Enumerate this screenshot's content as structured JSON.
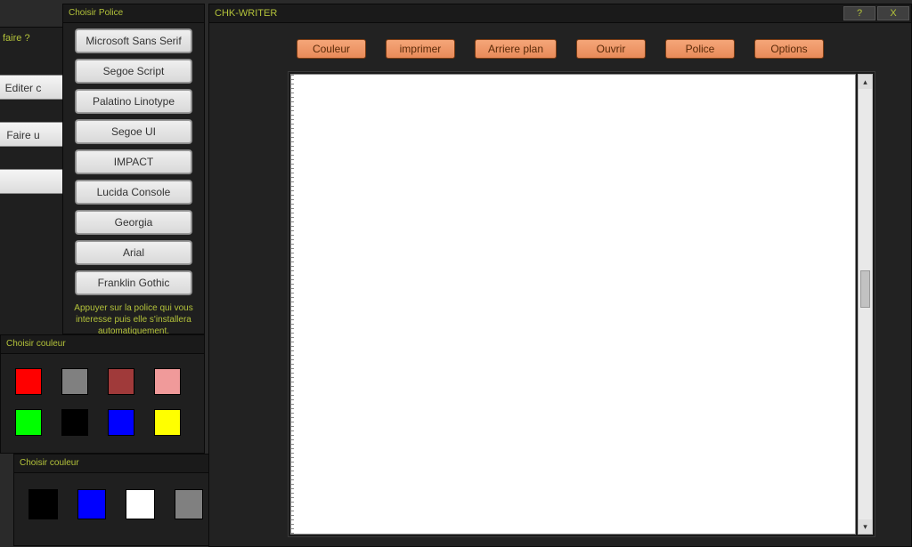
{
  "bgwin": {
    "question": "faire ?",
    "buttons": [
      "Editer c",
      "Faire u",
      ""
    ]
  },
  "fontwin": {
    "title": "Choisir Police",
    "fonts": [
      "Microsoft Sans Serif",
      "Segoe Script",
      "Palatino Linotype",
      "Segoe UI",
      "IMPACT",
      "Lucida Console",
      "Georgia",
      "Arial",
      "Franklin Gothic"
    ],
    "hint": "Appuyer sur la police qui vous interesse puis elle s'installera automatiquement."
  },
  "colorwin": {
    "title": "Choisir couleur",
    "row1": [
      "#ff0000",
      "#808080",
      "#a03a3a",
      "#f09a9a"
    ],
    "row2": [
      "#00ff00",
      "#000000",
      "#0000ff",
      "#ffff00"
    ]
  },
  "colorwin2": {
    "title": "Choisir couleur",
    "row1": [
      "#000000",
      "#0000ff",
      "#ffffff",
      "#808080"
    ]
  },
  "mainwin": {
    "title": "CHK-WRITER",
    "help": "?",
    "close": "X",
    "toolbar": [
      "Couleur",
      "imprimer",
      "Arriere plan",
      "Ouvrir",
      "Police",
      "Options"
    ],
    "sarrow_up": "▴",
    "sarrow_down": "▾"
  }
}
